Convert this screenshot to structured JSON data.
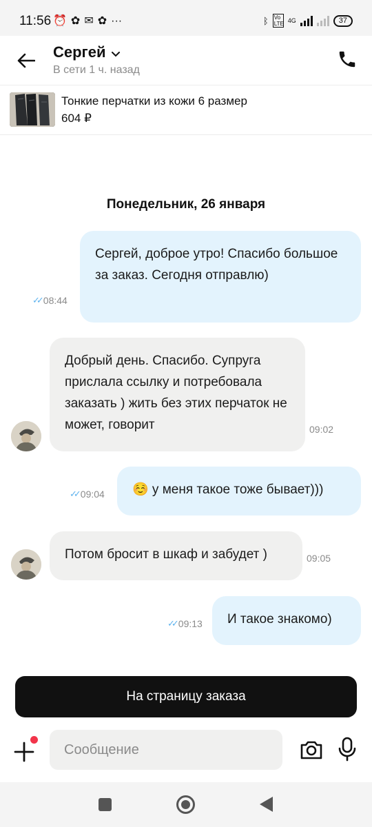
{
  "status_bar": {
    "time": "11:56",
    "network": "4G",
    "volte": "Vo LTE",
    "battery": "37"
  },
  "header": {
    "contact_name": "Сергей",
    "contact_status": "В сети 1 ч. назад"
  },
  "product": {
    "title": "Тонкие перчатки из кожи 6 размер",
    "price": "604 ₽"
  },
  "chat": {
    "date_divider": "Понедельник, 26 января",
    "messages": [
      {
        "direction": "outgoing",
        "text": "Сергей, доброе утро! Спасибо большое за заказ. Сегодня отправлю)",
        "time": "08:44",
        "read": true
      },
      {
        "direction": "incoming",
        "text": "Добрый день. Спасибо. Супруга прислала ссылку и потребовала заказать ) жить без этих перчаток не может, говорит",
        "time": "09:02"
      },
      {
        "direction": "outgoing",
        "text": "☺️ у меня такое тоже бывает)))",
        "time": "09:04",
        "read": true
      },
      {
        "direction": "incoming",
        "text": "Потом бросит в шкаф и забудет )",
        "time": "09:05"
      },
      {
        "direction": "outgoing",
        "text": "И такое знакомо)",
        "time": "09:13",
        "read": true
      }
    ]
  },
  "actions": {
    "order_page_button": "На страницу заказа"
  },
  "composer": {
    "placeholder": "Сообщение"
  },
  "colors": {
    "outgoing_bubble": "#e3f3fd",
    "incoming_bubble": "#f0f0ef",
    "read_ticks": "#5fb3ee",
    "primary_button": "#111111",
    "notification_dot": "#f2344a"
  },
  "icons": {
    "back": "arrow-left-icon",
    "call": "phone-icon",
    "dropdown": "chevron-down-icon",
    "attach": "plus-icon",
    "camera": "camera-icon",
    "mic": "microphone-icon"
  }
}
